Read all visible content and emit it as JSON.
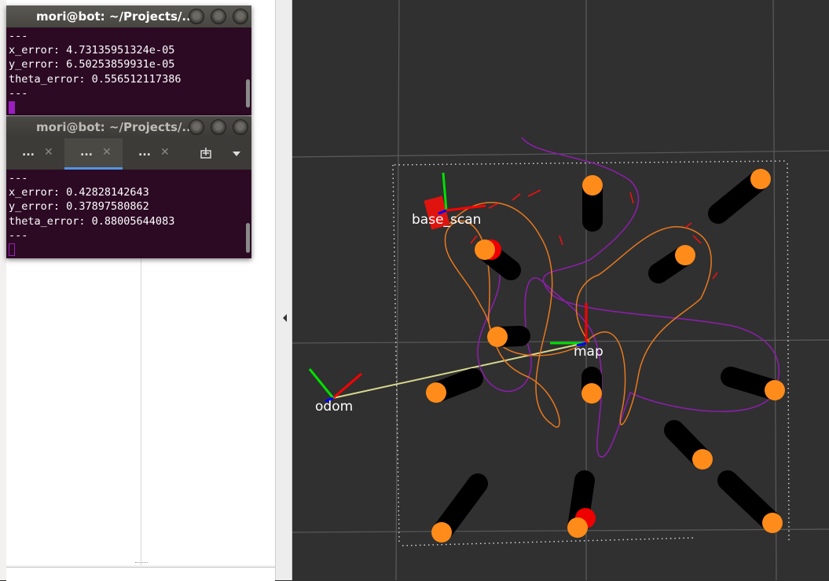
{
  "terminal1": {
    "title": "mori@bot: ~/Projects/...",
    "lines": [
      "---",
      "x_error: 4.73135951324e-05",
      "y_error: 6.50253859931e-05",
      "theta_error: 0.556512117386",
      "---"
    ]
  },
  "terminal2": {
    "title": "mori@bot: ~/Projects/...",
    "tabs": [
      {
        "label": "...",
        "close": "✕"
      },
      {
        "label": "...",
        "close": "✕"
      },
      {
        "label": "...",
        "close": "✕"
      }
    ],
    "lines": [
      "---",
      "x_error: 0.42828142643",
      "y_error: 0.37897580862",
      "theta_error: 0.88005644083",
      "---"
    ]
  },
  "viewport": {
    "frames": {
      "base_scan": "base_scan",
      "map": "map",
      "odom": "odom"
    }
  },
  "colors": {
    "viewport_bg": "#303030",
    "landmark": "#ff8c1a",
    "terminal_bg": "#2c0a24",
    "path_orange": "#e8791e",
    "path_purple": "#8a1fa8",
    "axis_x": "#ff0000",
    "axis_y": "#00ff00",
    "axis_z": "#0000ff"
  },
  "icons": {
    "window_close": "circle-button",
    "window_min": "circle-button",
    "window_max": "circle-button",
    "new_tab": "new-tab-icon",
    "tab_menu": "chevron-down-icon"
  }
}
